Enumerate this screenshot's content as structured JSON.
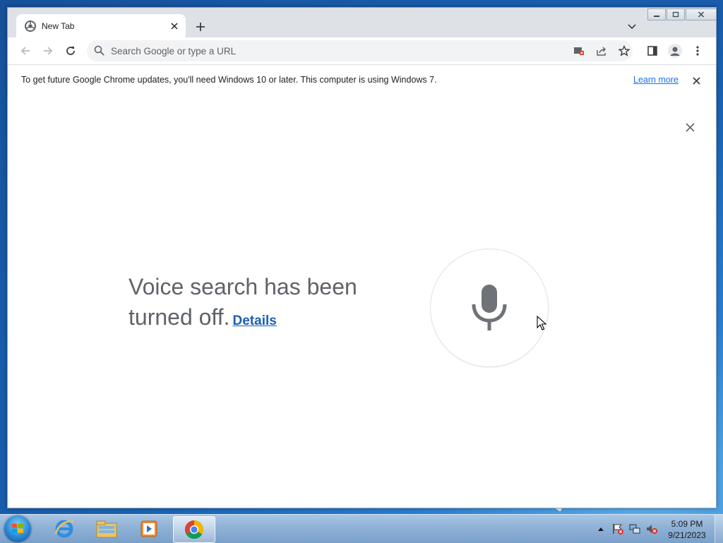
{
  "window": {
    "tab_title": "New Tab",
    "omnibox_placeholder": "Search Google or type a URL"
  },
  "infobar": {
    "message": "To get future Google Chrome updates, you'll need Windows 10 or later. This computer is using Windows 7.",
    "learn_more": "Learn more"
  },
  "voice_search": {
    "message": "Voice search has been turned off.",
    "details_link": "Details"
  },
  "taskbar": {
    "clock_time": "5:09 PM",
    "clock_date": "9/21/2023"
  },
  "icons": {
    "tab": "chrome-favicon",
    "nav": [
      "back-icon",
      "forward-icon",
      "reload-icon"
    ],
    "omnibox_right": [
      "blocked-popup-icon",
      "share-icon",
      "bookmark-star-icon"
    ],
    "toolbar_right": [
      "side-panel-icon",
      "profile-icon",
      "menu-icon"
    ],
    "taskbar_apps": [
      "internet-explorer-icon",
      "file-explorer-icon",
      "media-player-icon",
      "chrome-icon"
    ],
    "tray": [
      "show-hidden-icons",
      "action-center-icon",
      "network-icon",
      "volume-muted-icon"
    ]
  },
  "colors": {
    "link": "#1a73e8",
    "details_link": "#1a5fb4",
    "text_gray": "#5f6368",
    "tab_strip": "#dee1e6"
  }
}
